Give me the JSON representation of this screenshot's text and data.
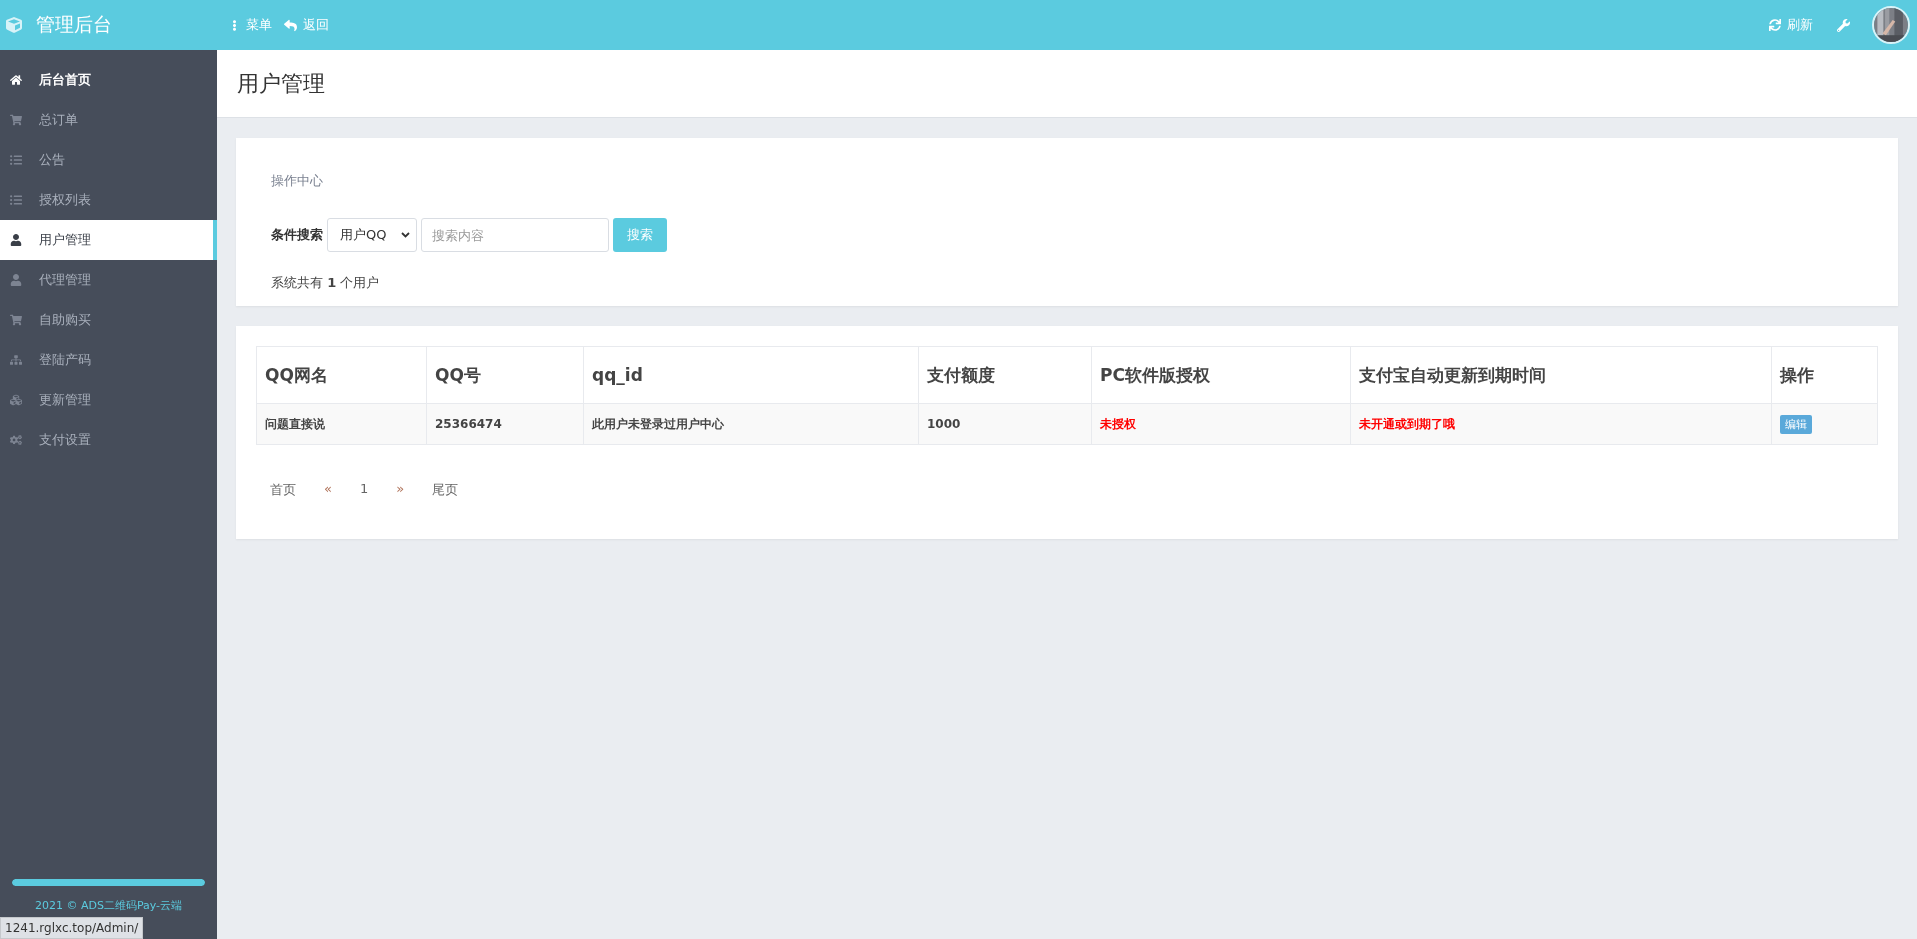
{
  "topbar": {
    "brand": "管理后台",
    "menu": "菜单",
    "back": "返回",
    "refresh": "刷新"
  },
  "sidebar": {
    "items": [
      {
        "label": "后台首页",
        "selected": false,
        "emphasis": true
      },
      {
        "label": "总订单",
        "selected": false,
        "emphasis": false
      },
      {
        "label": "公告",
        "selected": false,
        "emphasis": false
      },
      {
        "label": "授权列表",
        "selected": false,
        "emphasis": false
      },
      {
        "label": "用户管理",
        "selected": true,
        "emphasis": false
      },
      {
        "label": "代理管理",
        "selected": false,
        "emphasis": false
      },
      {
        "label": "自助购买",
        "selected": false,
        "emphasis": false
      },
      {
        "label": "登陆产码",
        "selected": false,
        "emphasis": false
      },
      {
        "label": "更新管理",
        "selected": false,
        "emphasis": false
      },
      {
        "label": "支付设置",
        "selected": false,
        "emphasis": false
      }
    ],
    "progress": {
      "level": 1
    },
    "footer": "2021 © ADS二维码Pay-云端",
    "status_url": "1241.rglxc.top/Admin/"
  },
  "page_title": "用户管理",
  "operations": {
    "title": "操作中心",
    "search_label": "条件搜索",
    "select_value": "用户QQ",
    "placeholder": "搜索内容",
    "search_button": "搜索",
    "summary": "系统共有 **1** 个用户"
  },
  "table": {
    "columns": [
      "QQ网名",
      "QQ号",
      "qq_id",
      "支付额度",
      "PC软件版授权",
      "支付宝自动更新到期时间",
      "操作"
    ],
    "rows": [
      {
        "cells": [
          {
            "text": "问题直接说",
            "kind": "text"
          },
          {
            "text": "25366474",
            "kind": "text"
          },
          {
            "text": "此用户未登录过用户中心",
            "kind": "text"
          },
          {
            "text": "1000",
            "kind": "text"
          },
          {
            "text": "未授权",
            "kind": "alert"
          },
          {
            "text": "未开通或到期了哦",
            "kind": "alert"
          },
          {
            "text": "编辑",
            "kind": "button"
          }
        ]
      }
    ]
  },
  "pagination": [
    "首页",
    "«",
    "1",
    "»",
    "尾页"
  ]
}
